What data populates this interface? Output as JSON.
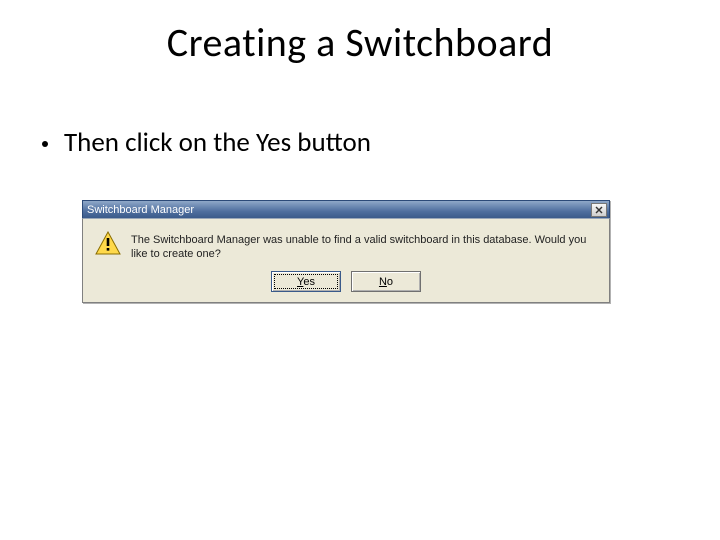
{
  "slide": {
    "title": "Creating a Switchboard",
    "bullet": "Then click on the Yes button"
  },
  "dialog": {
    "title": "Switchboard Manager",
    "message": "The Switchboard Manager was unable to find a valid switchboard in this database. Would you like to create one?",
    "buttons": {
      "yes": "Yes",
      "no": "No"
    }
  }
}
